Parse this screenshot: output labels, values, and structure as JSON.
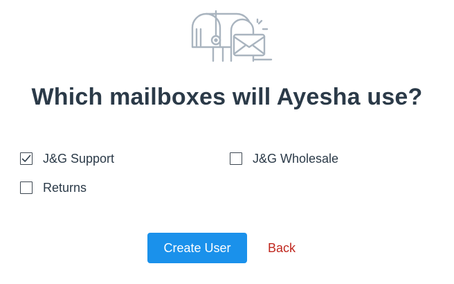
{
  "heading": "Which mailboxes will Ayesha use?",
  "mailboxes": [
    {
      "label": "J&G Support",
      "checked": true
    },
    {
      "label": "J&G Wholesale",
      "checked": false
    },
    {
      "label": "Returns",
      "checked": false
    }
  ],
  "actions": {
    "create_label": "Create User",
    "back_label": "Back"
  },
  "colors": {
    "primary_button": "#1a91eb",
    "back_link": "#c0271e",
    "heading": "#2b3a48",
    "illustration": "#a9b4bf"
  },
  "icons": {
    "illustration": "mailbox-illustration-icon",
    "checkbox_checked": "checkmark-icon"
  }
}
